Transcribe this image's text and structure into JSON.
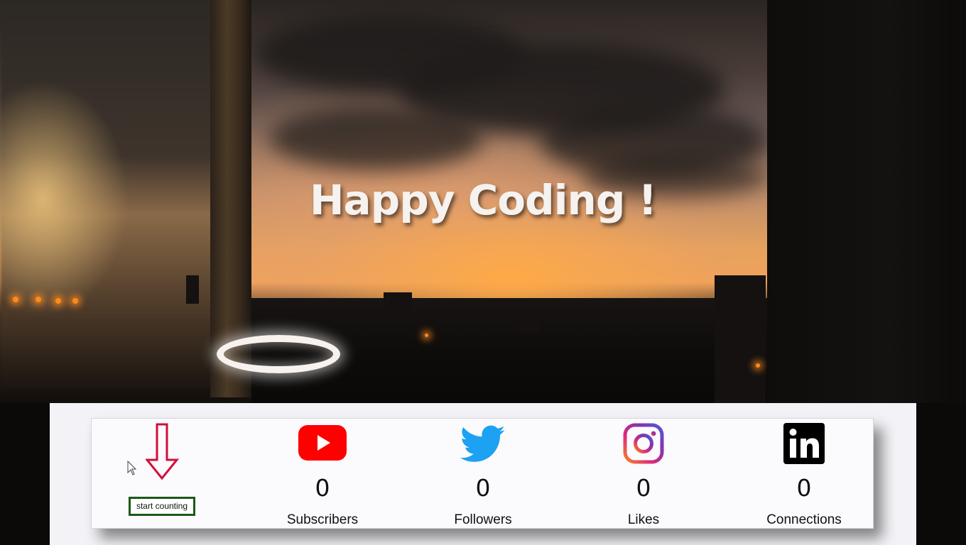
{
  "hero": {
    "title": "Happy Coding !"
  },
  "controls": {
    "start_label": "start counting"
  },
  "stats": [
    {
      "platform": "youtube",
      "icon": "youtube-icon",
      "count": "0",
      "label": "Subscribers",
      "color": "#ff0000"
    },
    {
      "platform": "twitter",
      "icon": "twitter-icon",
      "count": "0",
      "label": "Followers",
      "color": "#1da1f2"
    },
    {
      "platform": "instagram",
      "icon": "instagram-icon",
      "count": "0",
      "label": "Likes",
      "color": "#c13584"
    },
    {
      "platform": "linkedin",
      "icon": "linkedin-icon",
      "count": "0",
      "label": "Connections",
      "color": "#000000"
    }
  ],
  "colors": {
    "arrow": "#d0103a",
    "button_border": "#1a5a1a",
    "card_background": "#fbfafd"
  }
}
